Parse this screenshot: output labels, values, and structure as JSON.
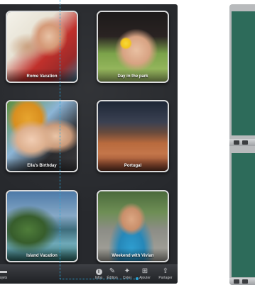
{
  "albums": [
    {
      "title": "Rome Vacation"
    },
    {
      "title": "Day in the park"
    },
    {
      "title": "Ella's Birthday"
    },
    {
      "title": "Portugal"
    },
    {
      "title": "Island Vacation"
    },
    {
      "title": "Weekend with Vivian"
    }
  ],
  "toolbar": {
    "projects_label": "ojets",
    "info_label": "Infos",
    "edit_label": "Édition",
    "create_label": "Créer",
    "add_label": "Ajouter",
    "share_label": "Partager"
  },
  "colors": {
    "accent_line": "#2aa5d8",
    "window_bg": "#27292d"
  }
}
